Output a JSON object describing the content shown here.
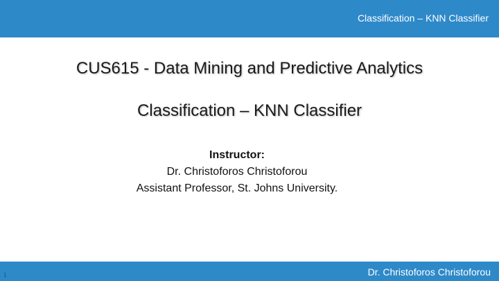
{
  "header": {
    "title": "Classification – KNN Classifier"
  },
  "title": {
    "main": "CUS615 - Data Mining and Predictive Analytics",
    "sub": "Classification – KNN Classifier"
  },
  "instructor": {
    "heading": "Instructor:",
    "name": "Dr. Christoforos Christoforou",
    "position": "Assistant Professor, St. Johns University."
  },
  "footer": {
    "author": "Dr. Christoforos Christoforou",
    "slide_number": "1"
  },
  "colors": {
    "accent_bar": "#2e89c9",
    "bar_text": "#ffffff",
    "body_text": "#1a1a1a"
  }
}
